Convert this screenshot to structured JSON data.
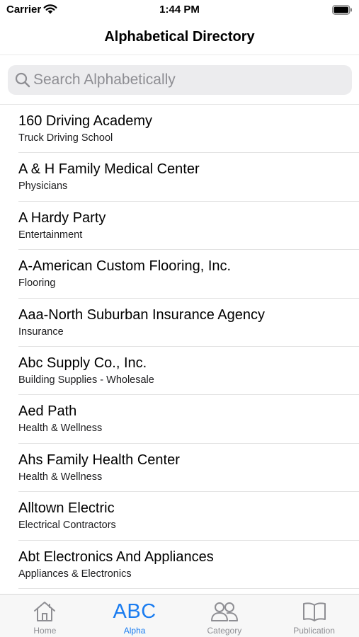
{
  "status_bar": {
    "carrier": "Carrier",
    "time": "1:44 PM"
  },
  "nav": {
    "title": "Alphabetical Directory"
  },
  "search": {
    "placeholder": "Search Alphabetically",
    "value": ""
  },
  "list": {
    "items": [
      {
        "title": "160 Driving Academy",
        "subtitle": "Truck Driving School"
      },
      {
        "title": "A & H Family Medical Center",
        "subtitle": "Physicians"
      },
      {
        "title": "A Hardy Party",
        "subtitle": "Entertainment"
      },
      {
        "title": "A-American Custom Flooring, Inc.",
        "subtitle": "Flooring"
      },
      {
        "title": "Aaa-North Suburban Insurance Agency",
        "subtitle": "Insurance"
      },
      {
        "title": "Abc Supply Co., Inc.",
        "subtitle": "Building Supplies - Wholesale"
      },
      {
        "title": "Aed Path",
        "subtitle": "Health & Wellness"
      },
      {
        "title": "Ahs Family Health Center",
        "subtitle": "Health & Wellness"
      },
      {
        "title": "Alltown Electric",
        "subtitle": "Electrical Contractors"
      },
      {
        "title": "Abt Electronics And Appliances",
        "subtitle": "Appliances & Electronics"
      }
    ]
  },
  "tabbar": {
    "tabs": [
      {
        "label": "Home",
        "icon": "house-icon",
        "active": false
      },
      {
        "label": "Alpha",
        "icon": "abc-icon",
        "glyph": "ABC",
        "active": true
      },
      {
        "label": "Category",
        "icon": "people-icon",
        "active": false
      },
      {
        "label": "Publication",
        "icon": "book-icon",
        "active": false
      }
    ]
  },
  "colors": {
    "accent": "#1a7cf0",
    "inactive": "#8e8e93",
    "search_bg": "#ececee"
  }
}
